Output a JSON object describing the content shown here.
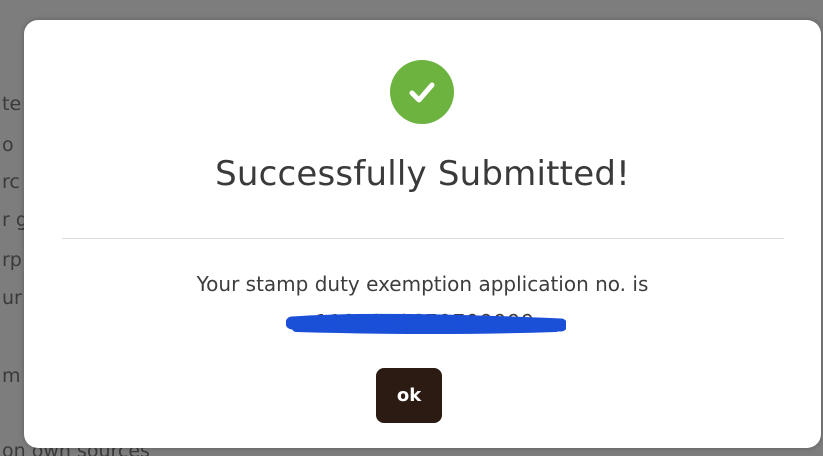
{
  "background": {
    "fragments": [
      "te",
      "o",
      "rc",
      "r g",
      "rp",
      "ur",
      "m"
    ],
    "bottom_text": "on own sources"
  },
  "dialog": {
    "icon": "check-circle-icon",
    "accent_color": "#6cb33f",
    "title": "Successfully Submitted!",
    "message": "Your stamp duty exemption application no. is",
    "application_number": "1191840679799999",
    "ok_label": "ok",
    "ok_color": "#2b1b12"
  }
}
